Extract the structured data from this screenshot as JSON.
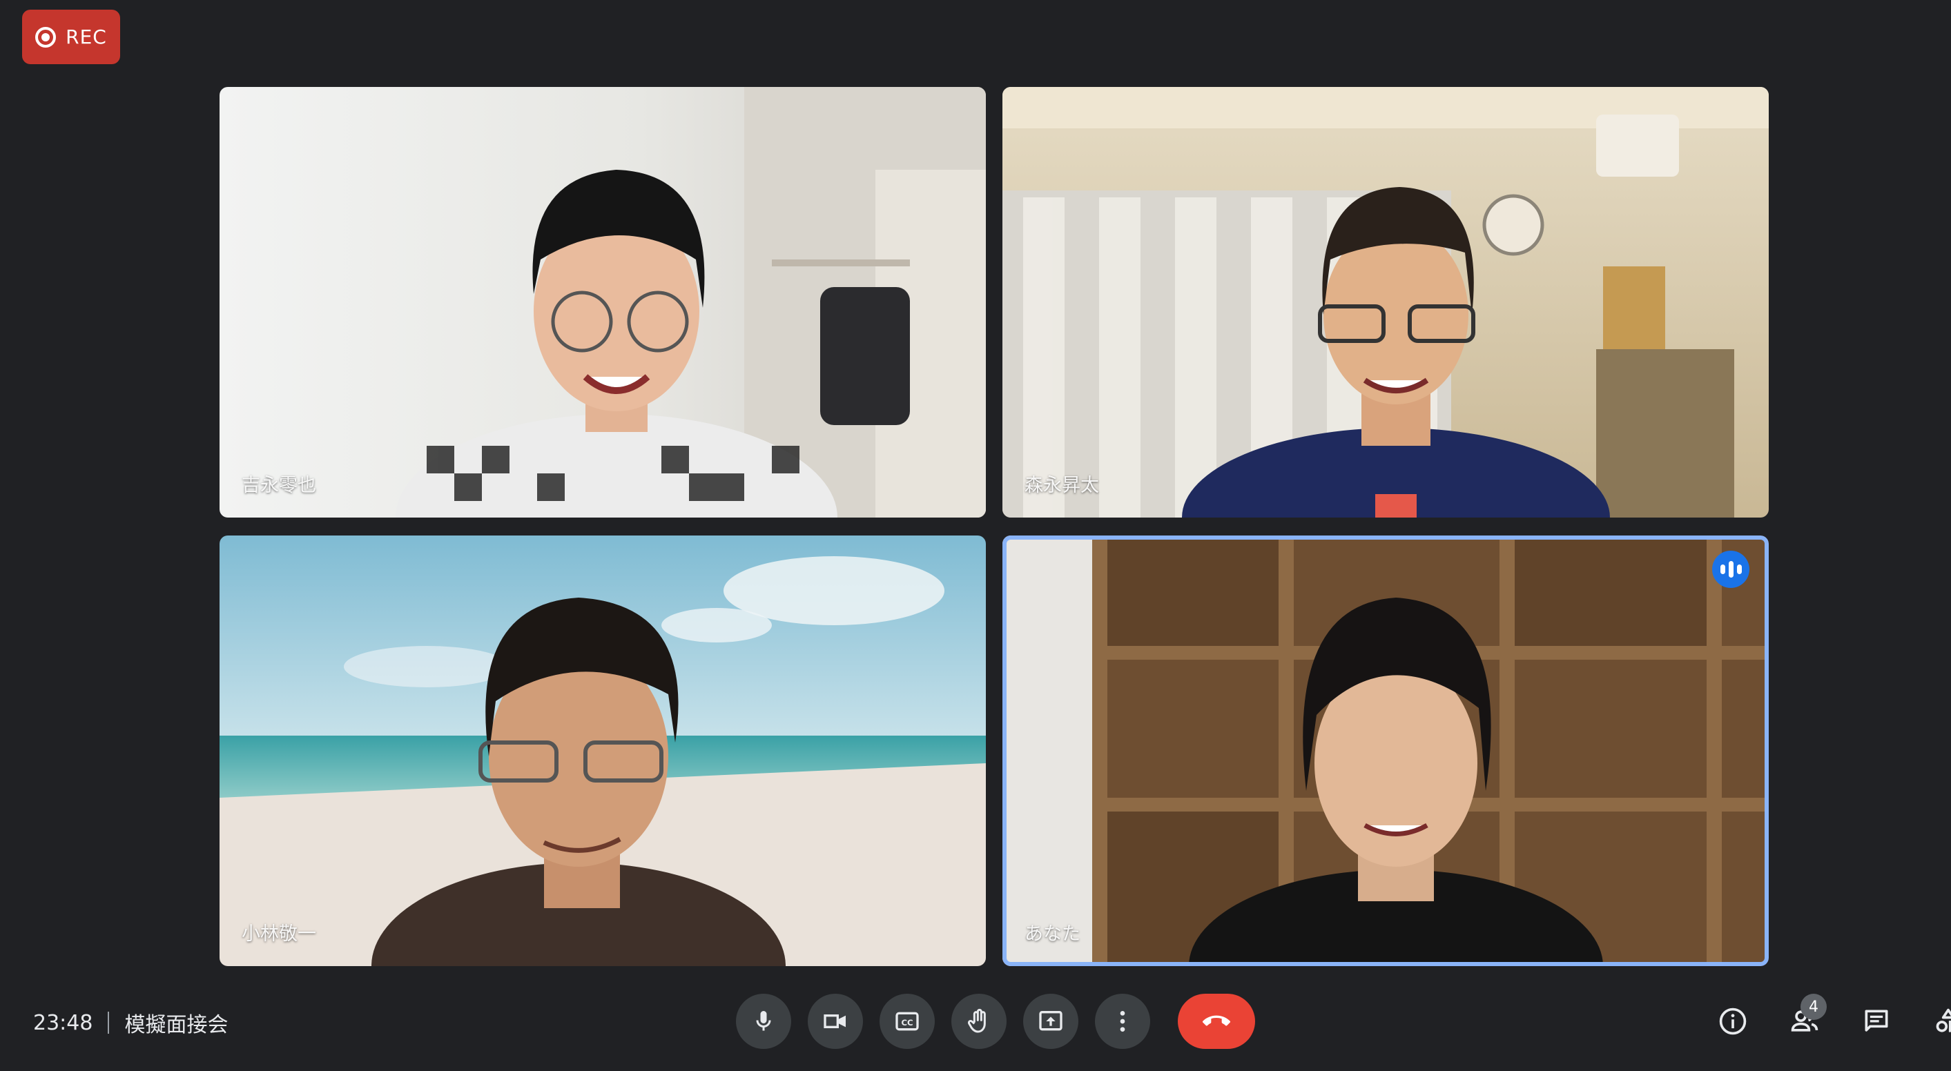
{
  "recording": {
    "label": "REC"
  },
  "participants": [
    {
      "name": "吉永零也"
    },
    {
      "name": "森永昇太"
    },
    {
      "name": "小林敬一"
    },
    {
      "name": "あなた"
    }
  ],
  "meeting": {
    "time": "23:48",
    "title": "模擬面接会"
  },
  "controls": {
    "mic_icon": "mic-icon",
    "camera_icon": "videocam-icon",
    "captions_icon": "closed-caption-icon",
    "raise_hand_icon": "hand-icon",
    "present_icon": "present-screen-icon",
    "more_icon": "more-vert-icon",
    "end_call_icon": "call-end-icon"
  },
  "side_panel": {
    "people_count": "4"
  },
  "colors": {
    "rec": "#c5362d",
    "end_call": "#ea4335",
    "speaking": "#8ab4f8"
  }
}
